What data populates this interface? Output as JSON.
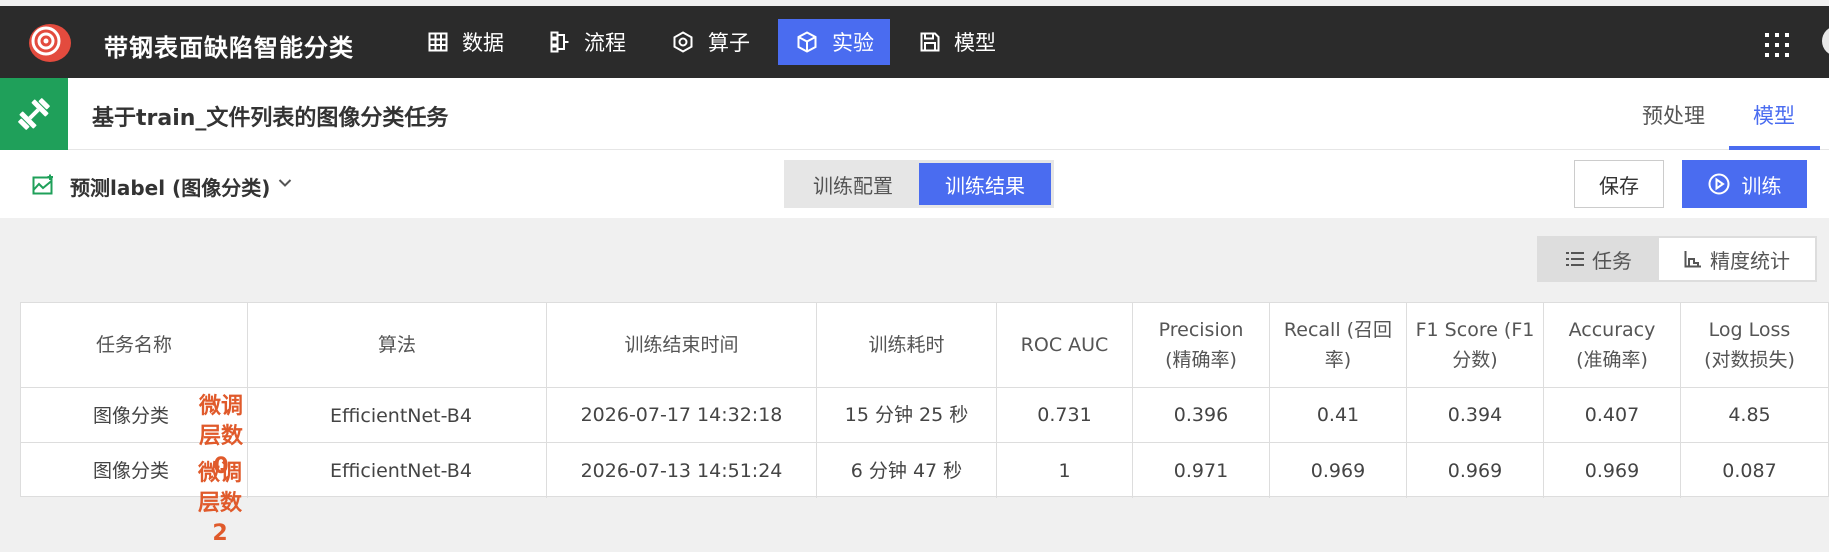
{
  "app": {
    "title": "带钢表面缺陷智能分类"
  },
  "nav": [
    {
      "label": "数据",
      "icon": "grid-table-icon",
      "active": false
    },
    {
      "label": "流程",
      "icon": "flow-icon",
      "active": false
    },
    {
      "label": "算子",
      "icon": "operator-hex-icon",
      "active": false
    },
    {
      "label": "实验",
      "icon": "cube-icon",
      "active": true
    },
    {
      "label": "模型",
      "icon": "save-model-icon",
      "active": false
    }
  ],
  "task": {
    "title": "基于train_文件列表的图像分类任务",
    "tabs": [
      {
        "label": "预处理",
        "active": false
      },
      {
        "label": "模型",
        "active": true
      }
    ]
  },
  "toolbar": {
    "target_label": "预测label (图像分类)",
    "segments": [
      {
        "label": "训练配置",
        "active": false
      },
      {
        "label": "训练结果",
        "active": true
      }
    ],
    "save_label": "保存",
    "train_label": "训练"
  },
  "view_toggle": {
    "tasks_label": "任务",
    "stats_label": "精度统计"
  },
  "table": {
    "headers": [
      "任务名称",
      "算法",
      "训练结束时间",
      "训练耗时",
      "ROC AUC",
      "Precision\n(精确率)",
      "Recall (召回\n率)",
      "F1 Score (F1\n分数)",
      "Accuracy\n(准确率)",
      "Log Loss\n(对数损失)"
    ],
    "rows": [
      {
        "task": "图像分类",
        "note": "微调层数0",
        "algo": "EfficientNet-B4",
        "end_time": "2026-07-17 14:32:18",
        "duration": "15 分钟 25 秒",
        "roc_auc": "0.731",
        "precision": "0.396",
        "recall": "0.41",
        "f1": "0.394",
        "accuracy": "0.407",
        "log_loss": "4.85"
      },
      {
        "task": "图像分类",
        "note": "微调层数2",
        "algo": "EfficientNet-B4",
        "end_time": "2026-07-13 14:51:24",
        "duration": "6 分钟 47 秒",
        "roc_auc": "1",
        "precision": "0.971",
        "recall": "0.969",
        "f1": "0.969",
        "accuracy": "0.969",
        "log_loss": "0.087"
      }
    ]
  },
  "colors": {
    "accent": "#4a6cf0",
    "topbar": "#2b2b2b",
    "task_badge": "#1fa05a",
    "note": "#e05a2b"
  }
}
